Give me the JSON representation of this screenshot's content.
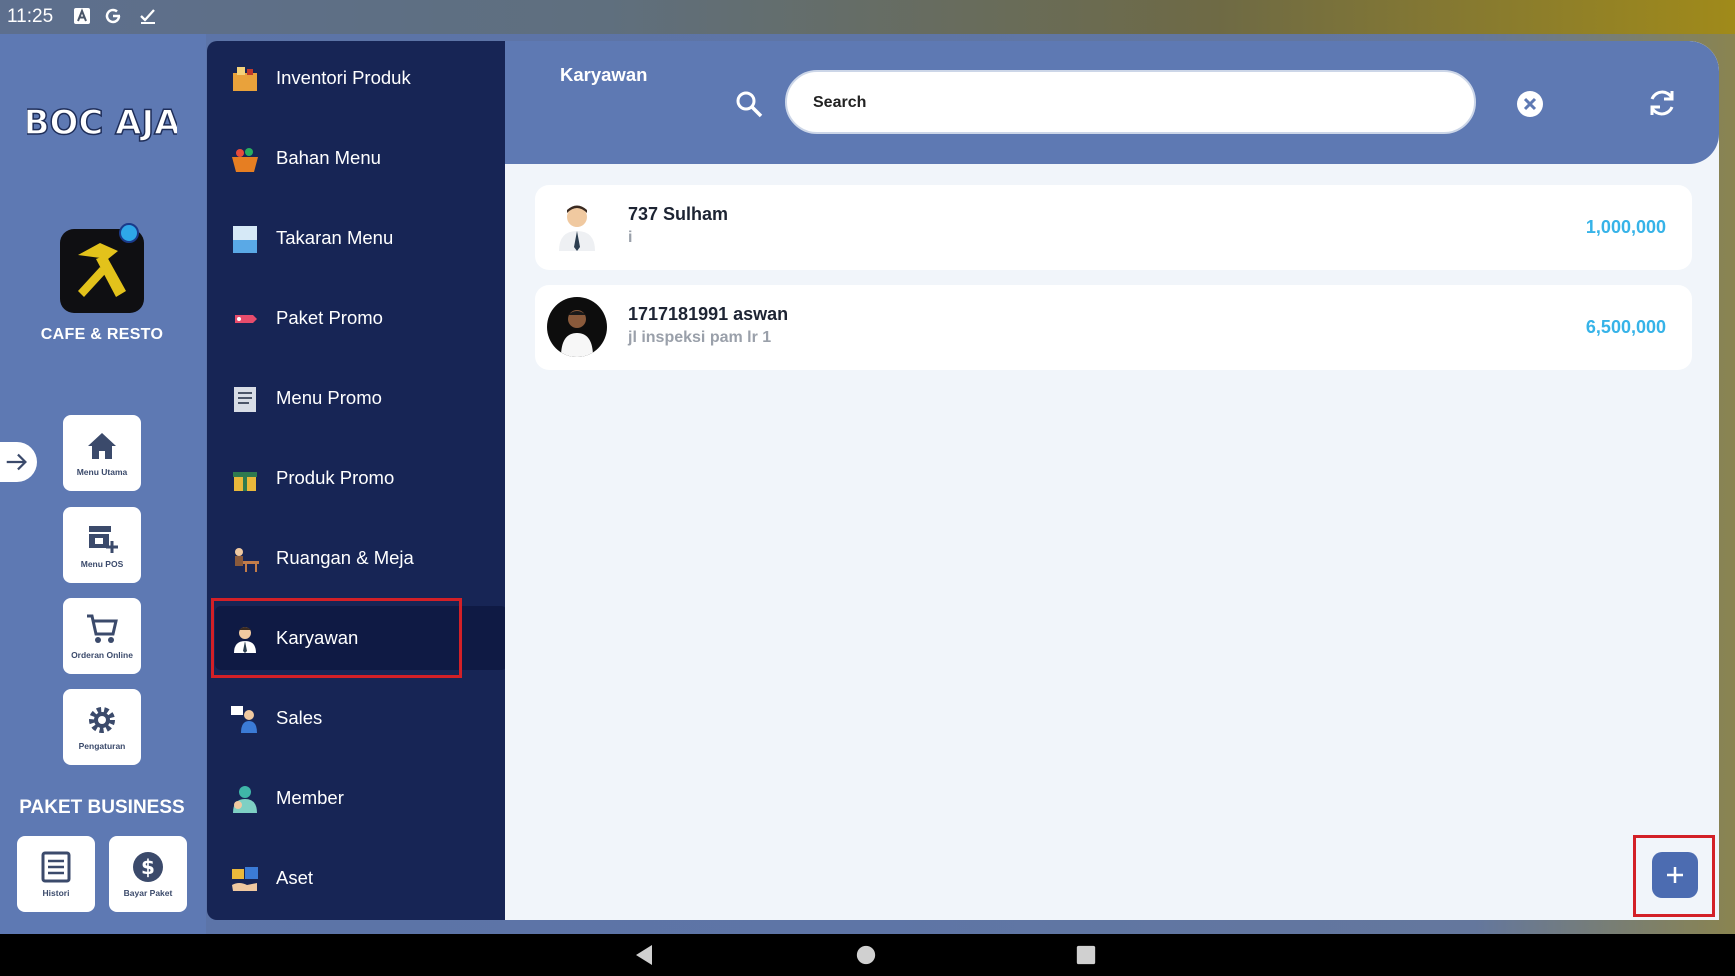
{
  "status_bar": {
    "time": "11:25"
  },
  "brand": {
    "logo_text": "BOC AJA",
    "business_type": "CAFE & RESTO"
  },
  "rail": {
    "tiles": [
      {
        "label": "Menu Utama",
        "icon": "home-icon"
      },
      {
        "label": "Menu POS",
        "icon": "store-add-icon"
      },
      {
        "label": "Orderan Online",
        "icon": "cart-icon"
      },
      {
        "label": "Pengaturan",
        "icon": "gear-icon"
      }
    ],
    "plan_title": "PAKET BUSINESS",
    "plan_tiles": [
      {
        "label": "Histori",
        "icon": "list-icon"
      },
      {
        "label": "Bayar Paket",
        "icon": "dollar-icon"
      }
    ]
  },
  "menu": {
    "items": [
      {
        "label": "Inventori Produk",
        "icon": "inventory-icon"
      },
      {
        "label": "Bahan Menu",
        "icon": "basket-icon"
      },
      {
        "label": "Takaran Menu",
        "icon": "measuring-cup-icon"
      },
      {
        "label": "Paket Promo",
        "icon": "promo-tag-icon"
      },
      {
        "label": "Menu Promo",
        "icon": "menu-card-icon"
      },
      {
        "label": "Produk Promo",
        "icon": "gift-box-icon"
      },
      {
        "label": "Ruangan & Meja",
        "icon": "table-icon"
      },
      {
        "label": "Karyawan",
        "icon": "employee-icon"
      },
      {
        "label": "Sales",
        "icon": "sales-icon"
      },
      {
        "label": "Member",
        "icon": "member-icon"
      },
      {
        "label": "Aset",
        "icon": "asset-icon"
      }
    ],
    "active": "Karyawan"
  },
  "header": {
    "title": "Karyawan",
    "search_placeholder": "Search"
  },
  "employees": [
    {
      "name": "737 Sulham",
      "address": "i",
      "amount": "1,000,000"
    },
    {
      "name": "1717181991 aswan",
      "address": "jl inspeksi pam lr 1",
      "amount": "6,500,000"
    }
  ],
  "colors": {
    "accent": "#5e79b3",
    "menu_bg": "#172555",
    "amount": "#36b3e8",
    "highlight": "#d32027"
  }
}
